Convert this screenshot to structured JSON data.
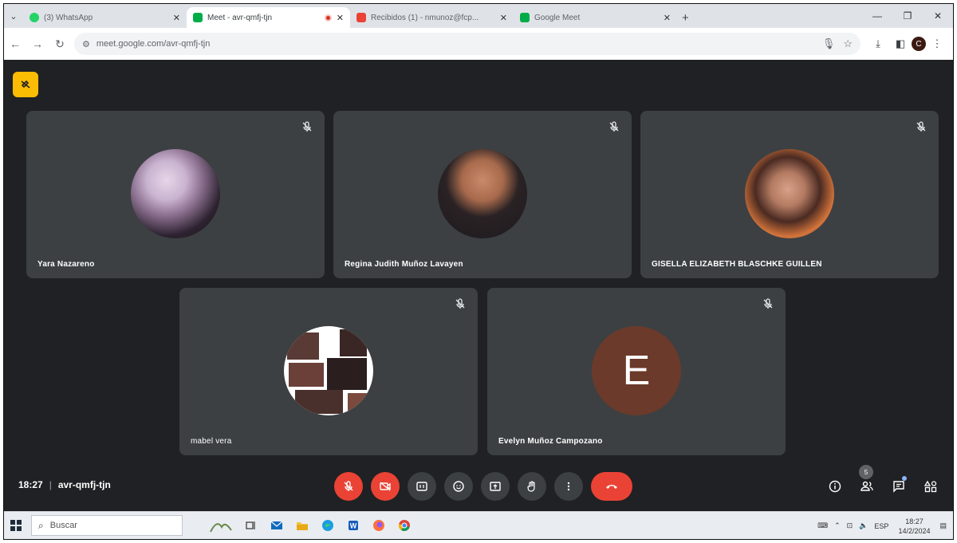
{
  "browser": {
    "tabs": [
      {
        "title": "(3) WhatsApp",
        "active": false
      },
      {
        "title": "Meet - avr-qmfj-tjn",
        "active": true,
        "recording": true
      },
      {
        "title": "Recibidos (1) - nmunoz@fcp...",
        "active": false
      },
      {
        "title": "Google Meet",
        "active": false
      }
    ],
    "url": "meet.google.com/avr-qmfj-tjn",
    "profile_initial": "C"
  },
  "meet": {
    "participants": [
      {
        "name": "Yara Nazareno",
        "avatar": "photo",
        "muted": true
      },
      {
        "name": "Regina Judith Muñoz Lavayen",
        "avatar": "photo",
        "muted": true
      },
      {
        "name": "GISELLA ELIZABETH BLASCHKE GUILLEN",
        "avatar": "photo",
        "muted": true
      },
      {
        "name": "mabel vera",
        "avatar": "photo",
        "muted": true
      },
      {
        "name": "Evelyn Muñoz Campozano",
        "avatar": "letter",
        "initial": "E",
        "muted": true
      }
    ],
    "time": "18:27",
    "meeting_code": "avr-qmfj-tjn",
    "people_count": "5",
    "colors": {
      "background": "#202124",
      "tile": "#3c4043",
      "danger": "#ea4335",
      "host": "#fbbc04",
      "initial_avatar": "#6b3a2a"
    }
  },
  "taskbar": {
    "search_placeholder": "Buscar",
    "language": "ESP",
    "clock_time": "18:27",
    "clock_date": "14/2/2024"
  }
}
